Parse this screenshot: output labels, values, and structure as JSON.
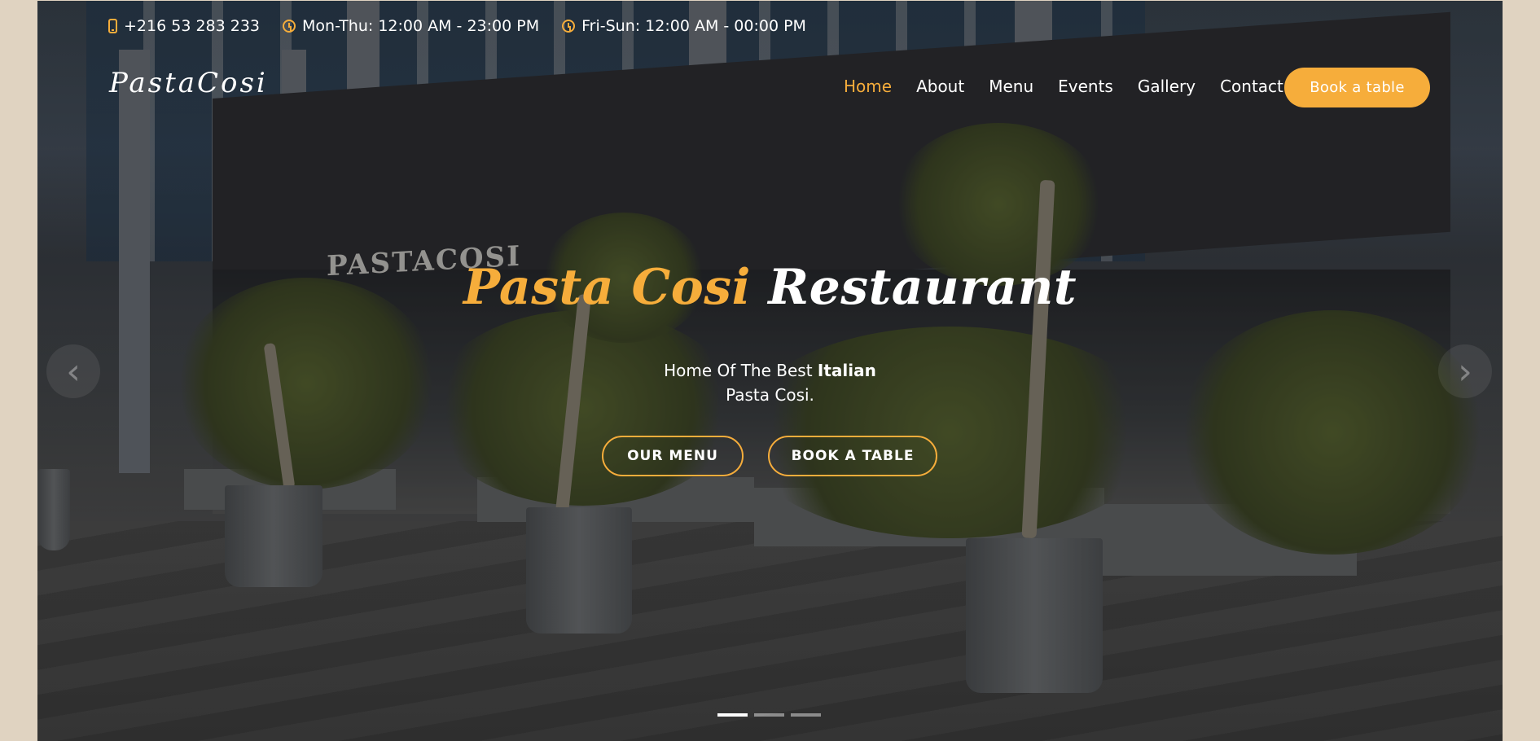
{
  "topbar": {
    "phone": "+216 53 283 233",
    "hours_weekday": "Mon-Thu: 12:00 AM - 23:00 PM",
    "hours_weekend": "Fri-Sun: 12:00 AM - 00:00 PM"
  },
  "brand": {
    "logo": "PastaCosi"
  },
  "nav": {
    "items": [
      {
        "label": "Home",
        "active": true
      },
      {
        "label": "About",
        "active": false
      },
      {
        "label": "Menu",
        "active": false
      },
      {
        "label": "Events",
        "active": false
      },
      {
        "label": "Gallery",
        "active": false
      },
      {
        "label": "Contact",
        "active": false
      }
    ],
    "book_button": "Book a table"
  },
  "hero": {
    "title_accent": "Pasta Cosi",
    "title_rest": "Restaurant",
    "subtitle_prefix": "Home Of The Best",
    "subtitle_bold": "Italian",
    "subtitle_line2": "Pasta Cosi.",
    "cta_menu": "OUR MENU",
    "cta_book": "BOOK A TABLE",
    "storefront_sign": "PASTACOSI"
  },
  "carousel": {
    "slides": 3,
    "active_slide": 1
  },
  "icons": {
    "phone": "phone-icon",
    "clock": "clock-icon",
    "prev": "chevron-left-icon",
    "next": "chevron-right-icon"
  },
  "colors": {
    "accent": "#f6ad3b",
    "page_bg": "#e0d3c1",
    "text": "#ffffff"
  }
}
